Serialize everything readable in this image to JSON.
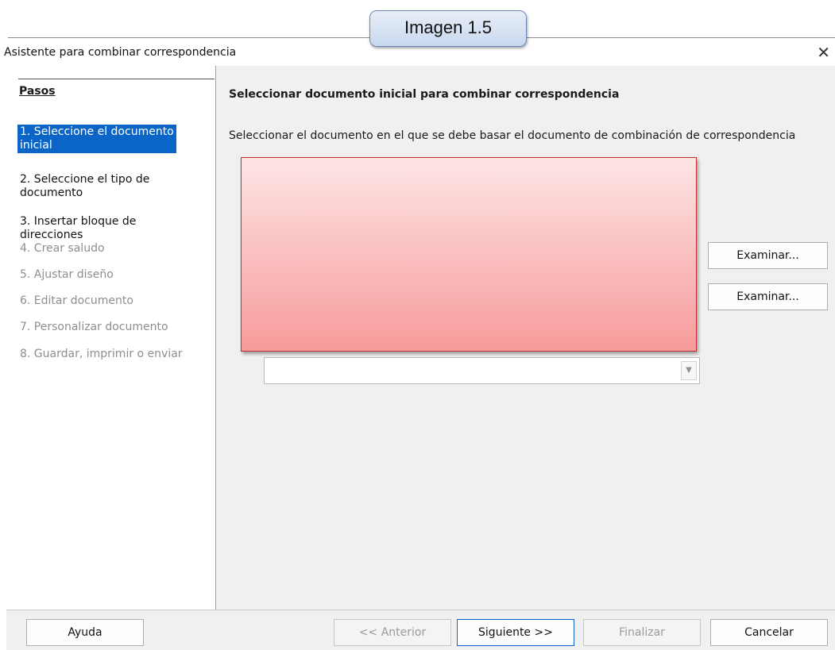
{
  "caption": "Imagen 1.5",
  "window": {
    "title": "Asistente para combinar correspondencia",
    "close_icon": "close-icon"
  },
  "sidebar": {
    "heading": "Pasos",
    "steps": [
      {
        "label": "1. Seleccione el documento inicial",
        "state": "active"
      },
      {
        "label": "2. Seleccione el tipo de documento",
        "state": "enabled"
      },
      {
        "label": "3. Insertar bloque de direcciones",
        "state": "enabled"
      },
      {
        "label": "4. Crear saludo",
        "state": "disabled"
      },
      {
        "label": "5. Ajustar diseño",
        "state": "disabled"
      },
      {
        "label": "6. Editar documento",
        "state": "disabled"
      },
      {
        "label": "7. Personalizar documento",
        "state": "disabled"
      },
      {
        "label": "8. Guardar, imprimir o enviar",
        "state": "disabled"
      }
    ]
  },
  "main": {
    "title": "Seleccionar documento inicial para combinar correspondencia",
    "description": "Seleccionar el documento en el que se debe basar el documento de combinación de correspondencia",
    "browse_buttons": [
      "Examinar...",
      "Examinar..."
    ],
    "template_select_value": ""
  },
  "footer": {
    "help": "Ayuda",
    "previous": "<< Anterior",
    "next": "Siguiente >>",
    "finish": "Finalizar",
    "cancel": "Cancelar"
  },
  "colors": {
    "selection": "#0a65c6",
    "redaction": "#f79b9b"
  }
}
